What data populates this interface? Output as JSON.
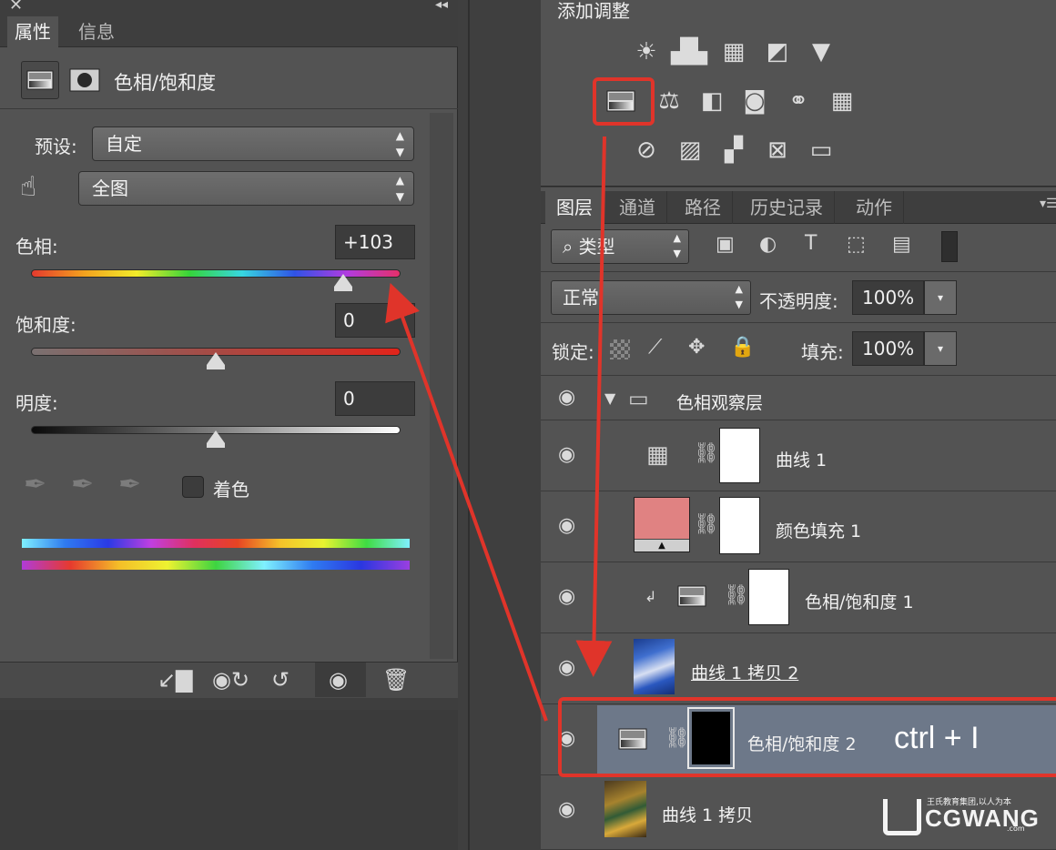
{
  "properties_panel": {
    "tabs": [
      "属性",
      "信息"
    ],
    "title": "色相/饱和度",
    "preset_label": "预设:",
    "preset_value": "自定",
    "channel_value": "全图",
    "hue_label": "色相:",
    "hue_value": "+103",
    "saturation_label": "饱和度:",
    "saturation_value": "0",
    "lightness_label": "明度:",
    "lightness_value": "0",
    "colorize_label": "着色"
  },
  "adjustments_panel": {
    "title": "添加调整"
  },
  "layers_panel": {
    "tabs": [
      "图层",
      "通道",
      "路径",
      "历史记录",
      "动作"
    ],
    "filter_kind": "类型",
    "blend_mode": "正常",
    "opacity_label": "不透明度:",
    "opacity_value": "100%",
    "lock_label": "锁定:",
    "fill_label": "填充:",
    "fill_value": "100%",
    "layers": [
      {
        "name": "色相观察层"
      },
      {
        "name": "曲线 1"
      },
      {
        "name": "颜色填充 1"
      },
      {
        "name": "色相/饱和度 1"
      },
      {
        "name": "曲线 1 拷贝 2"
      },
      {
        "name": "色相/饱和度 2"
      },
      {
        "name": "曲线 1 拷贝"
      }
    ]
  },
  "annotation": {
    "shortcut": "ctrl + I"
  },
  "watermark": {
    "brand": "CGWANG",
    "slogan": "王氏教育集团,以人为本",
    "domain": ".com"
  },
  "colors": {
    "annotation_red": "#e0342a",
    "selected_row": "#6d7889",
    "color_fill_swatch": "#e08282"
  }
}
